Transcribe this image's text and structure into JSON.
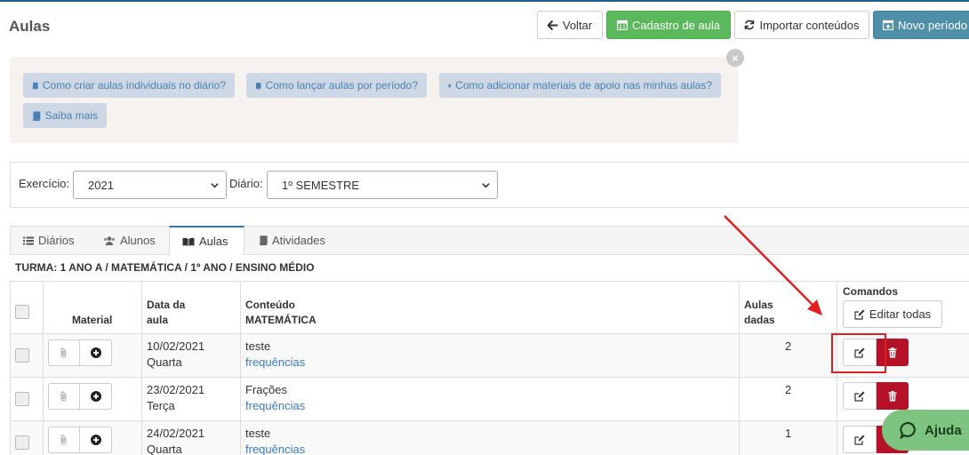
{
  "page": {
    "title": "Aulas"
  },
  "toolbar": {
    "voltar": "Voltar",
    "cadastro": "Cadastro de aula",
    "importar": "Importar conteúdos",
    "novo": "Novo período"
  },
  "help": {
    "links": [
      "Como criar aulas individuais no diário?",
      "Como lançar aulas por período?",
      "Como adicionar materiais de apoio nas minhas aulas?",
      "Saiba mais"
    ],
    "close": "×"
  },
  "filters": {
    "exercicio_label": "Exercício:",
    "exercicio_value": "2021",
    "diario_label": "Diário:",
    "diario_value": "1º SEMESTRE"
  },
  "tabs": [
    {
      "label": "Diários"
    },
    {
      "label": "Alunos"
    },
    {
      "label": "Aulas"
    },
    {
      "label": "Atividades"
    }
  ],
  "turma": "TURMA: 1 ANO A / MATEMÁTICA / 1º ANO / ENSINO MÉDIO",
  "table": {
    "headers": {
      "material": "Material",
      "data_l1": "Data da",
      "data_l2": "aula",
      "conteudo_l1": "Conteúdo",
      "conteudo_l2": "MATEMÁTICA",
      "aulas_l1": "Aulas",
      "aulas_l2": "dadas",
      "comandos": "Comandos",
      "editar_todas": "Editar todas"
    },
    "rows": [
      {
        "date": "10/02/2021",
        "weekday": "Quarta",
        "content": "teste",
        "link": "frequências",
        "aulas": "2"
      },
      {
        "date": "23/02/2021",
        "weekday": "Terça",
        "content": "Frações",
        "link": "frequências",
        "aulas": "2"
      },
      {
        "date": "24/02/2021",
        "weekday": "Quarta",
        "content": "teste",
        "link": "frequências",
        "aulas": "1"
      }
    ]
  },
  "ajuda": {
    "label": "Ajuda"
  },
  "colors": {
    "accent": "#3b6ea5",
    "success": "#5cb85c",
    "danger": "#b5122a",
    "info": "#4f8fa8",
    "highlight": "#e02020"
  }
}
